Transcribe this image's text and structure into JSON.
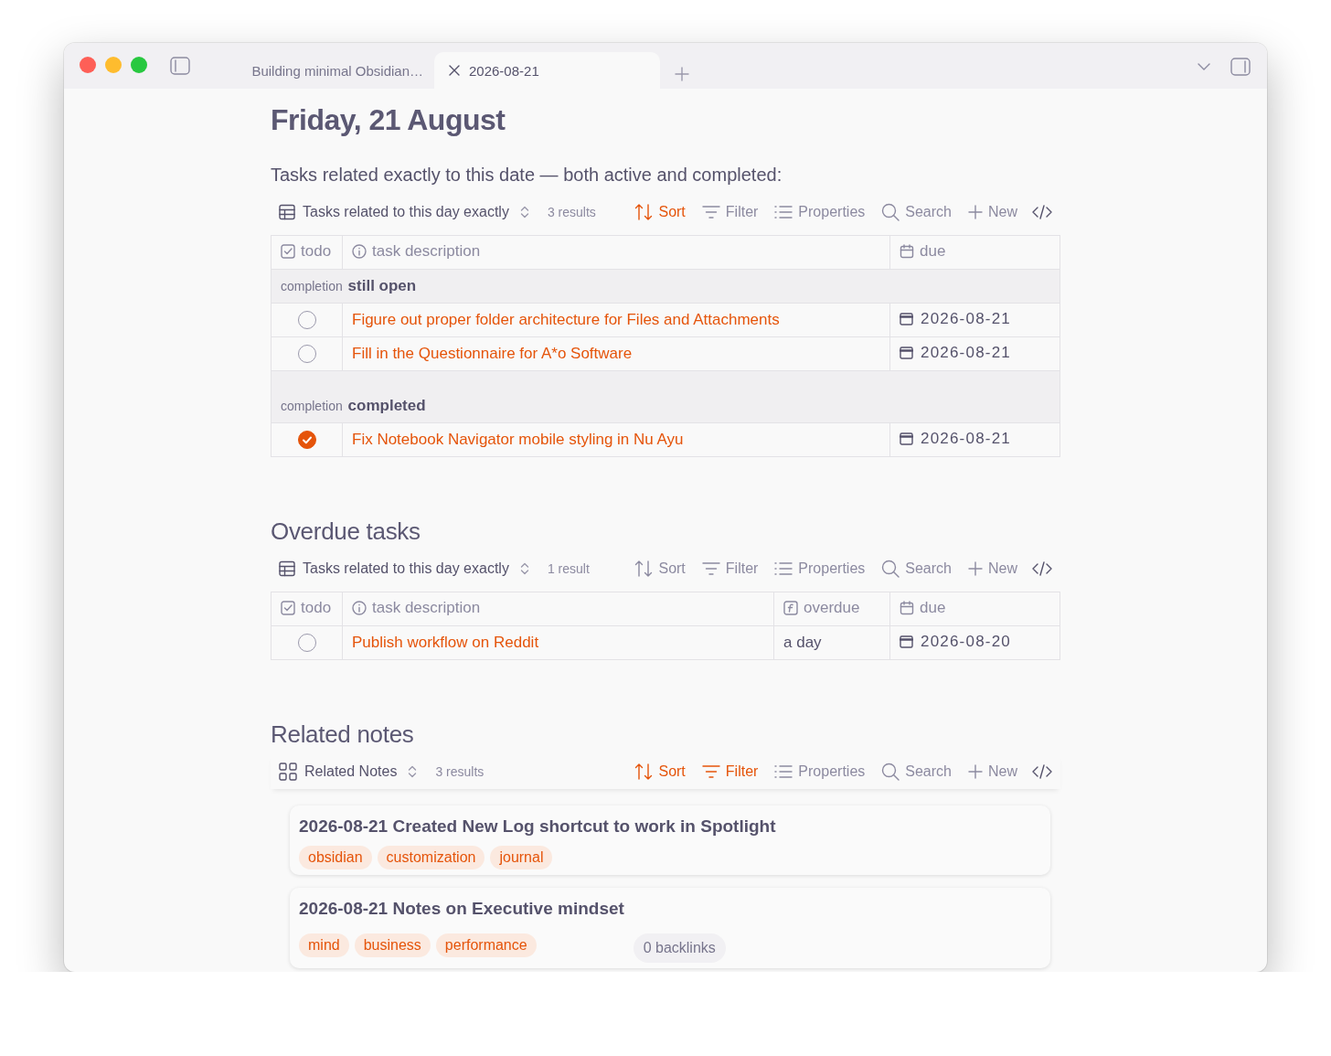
{
  "window": {
    "tabs": [
      {
        "label": "Building minimal Obsidian…",
        "selected": false
      },
      {
        "label": "2026-08-21",
        "selected": true
      }
    ]
  },
  "note": {
    "title": "Friday, 21 August",
    "intro": "Tasks related exactly to this date — both active and completed:"
  },
  "bases": [
    {
      "toolbar": {
        "view": "Tasks related to this day exactly",
        "kind": "table",
        "results": "3 results",
        "buttons": [
          {
            "kind": "sort",
            "label": "Sort",
            "active": true
          },
          {
            "kind": "filter",
            "label": "Filter",
            "active": false
          },
          {
            "kind": "properties",
            "label": "Properties",
            "active": false
          },
          {
            "kind": "search",
            "label": "Search",
            "active": false
          },
          {
            "kind": "new",
            "label": "New",
            "active": false
          }
        ]
      },
      "table": {
        "columns": [
          {
            "kind": "checkbox",
            "label": "todo"
          },
          {
            "kind": "text",
            "label": "task description"
          },
          {
            "kind": "date",
            "label": "due"
          }
        ],
        "groups": [
          {
            "property": "completion",
            "value": "still open",
            "rows": [
              {
                "done": false,
                "cells": [
                  "Figure out proper folder architecture for Files and Attachments",
                  "2026-08-21"
                ]
              },
              {
                "done": false,
                "cells": [
                  "Fill in the Questionnaire for A*o Software",
                  "2026-08-21"
                ]
              }
            ]
          },
          {
            "property": "completion",
            "value": "completed",
            "rows": [
              {
                "done": true,
                "cells": [
                  "Fix Notebook Navigator mobile styling in Nu Ayu",
                  "2026-08-21"
                ]
              }
            ]
          }
        ]
      }
    },
    {
      "heading": "Overdue tasks",
      "toolbar": {
        "view": "Tasks related to this day exactly",
        "kind": "table",
        "results": "1 result",
        "buttons": [
          {
            "kind": "sort",
            "label": "Sort",
            "active": false
          },
          {
            "kind": "filter",
            "label": "Filter",
            "active": false
          },
          {
            "kind": "properties",
            "label": "Properties",
            "active": false
          },
          {
            "kind": "search",
            "label": "Search",
            "active": false
          },
          {
            "kind": "new",
            "label": "New",
            "active": false
          }
        ]
      },
      "table": {
        "columns": [
          {
            "kind": "checkbox",
            "label": "todo"
          },
          {
            "kind": "text",
            "label": "task description"
          },
          {
            "kind": "formula",
            "label": "overdue"
          },
          {
            "kind": "date",
            "label": "due"
          }
        ],
        "groups": [
          {
            "rows": [
              {
                "done": false,
                "cells": [
                  "Publish workflow on Reddit",
                  "a day",
                  "2026-08-20"
                ]
              }
            ]
          }
        ]
      }
    },
    {
      "heading": "Related notes",
      "toolbar": {
        "view": "Related Notes",
        "kind": "cards",
        "results": "3 results",
        "buttons": [
          {
            "kind": "sort",
            "label": "Sort",
            "active": true
          },
          {
            "kind": "filter",
            "label": "Filter",
            "active": true
          },
          {
            "kind": "properties",
            "label": "Properties",
            "active": false
          },
          {
            "kind": "search",
            "label": "Search",
            "active": false
          },
          {
            "kind": "new",
            "label": "New",
            "active": false
          }
        ]
      },
      "cards": [
        {
          "title": "2026-08-21 Created New Log shortcut to work in Spotlight",
          "tags": [
            "obsidian",
            "customization",
            "journal"
          ]
        },
        {
          "title": "2026-08-21 Notes on Executive mindset",
          "tags": [
            "mind",
            "business",
            "performance"
          ],
          "backlinks": "0 backlinks"
        }
      ]
    }
  ]
}
